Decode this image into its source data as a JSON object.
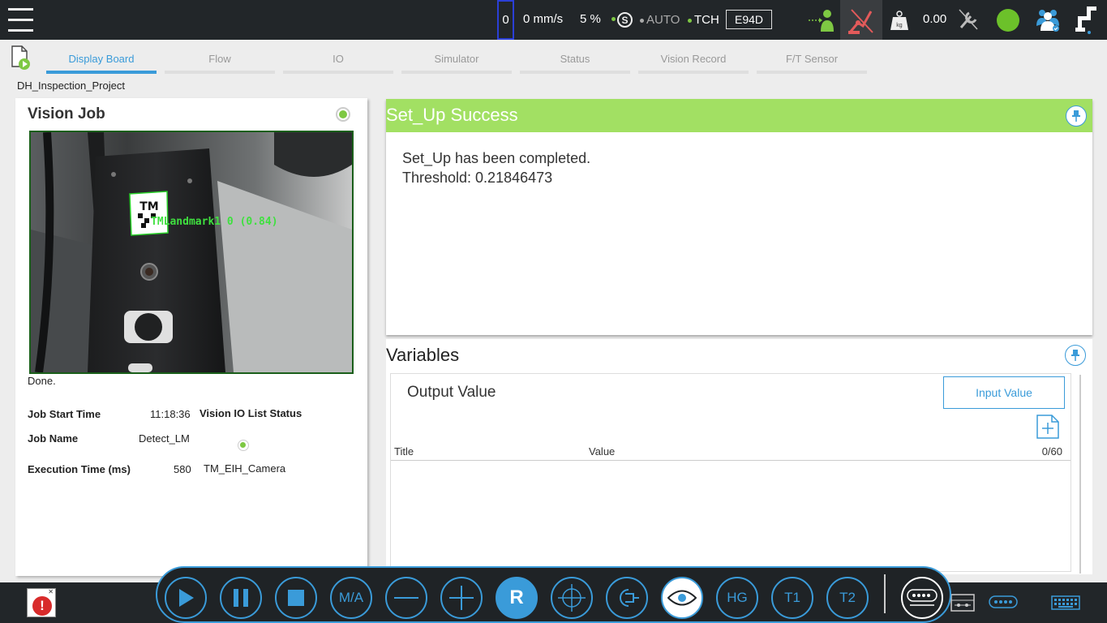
{
  "topbar": {
    "counter": "0",
    "speed": "0 mm/s",
    "percent": "5 %",
    "s_label": "S",
    "mode_auto": "AUTO",
    "mode_tch": "TCH",
    "robot_id": "E94D",
    "payload": "0.00",
    "weight_unit": "kg"
  },
  "tabs": [
    {
      "label": "Display Board"
    },
    {
      "label": "Flow"
    },
    {
      "label": "IO"
    },
    {
      "label": "Simulator"
    },
    {
      "label": "Status"
    },
    {
      "label": "Vision Record"
    },
    {
      "label": "F/T Sensor"
    }
  ],
  "project": {
    "name": "DH_Inspection_Project"
  },
  "vision_job": {
    "title": "Vision Job",
    "overlay_text": "TMLandmark1 0 (0.84)",
    "marker_text": "TM",
    "status_text": "Done.",
    "job_start_time_label": "Job Start Time",
    "job_start_time_value": "11:18:36",
    "io_list_status_label": "Vision IO List Status",
    "job_name_label": "Job Name",
    "job_name_value": "Detect_LM",
    "execution_time_label": "Execution Time (ms)",
    "execution_time_value": "580",
    "camera_name": "TM_EIH_Camera"
  },
  "setup": {
    "title": "Set_Up Success",
    "message_line1": "Set_Up has been completed.",
    "message_line2": "Threshold: 0.21846473"
  },
  "variables": {
    "title": "Variables",
    "output_title": "Output Value",
    "input_button": "Input Value",
    "col_title": "Title",
    "col_value": "Value",
    "count": "0/60"
  },
  "dock": {
    "ma": "M/A",
    "r": "R",
    "hg": "HG",
    "t1": "T1",
    "t2": "T2"
  },
  "colors": {
    "accent": "#3a9bd9",
    "success": "#a2e063",
    "status_green": "#7ec843",
    "error": "#d82b2b",
    "topbar_bg": "#222629"
  }
}
